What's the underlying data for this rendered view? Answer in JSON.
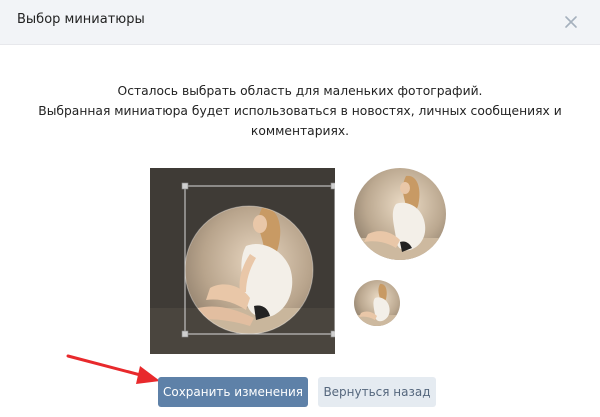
{
  "dialog": {
    "title": "Выбор миниатюры",
    "close_icon": "close-icon"
  },
  "instructions": {
    "line1": "Осталось выбрать область для маленьких фотографий.",
    "line2": "Выбранная миниатюра будет использоваться в новостях, личных сообщениях и",
    "line3": "комментариях."
  },
  "editor": {
    "crop_icon": "crop-selection",
    "photo_icon": "photo-woman-sitting"
  },
  "previews": {
    "large_icon": "photo-thumbnail-large",
    "small_icon": "photo-thumbnail-small"
  },
  "buttons": {
    "save_label": "Сохранить изменения",
    "back_label": "Вернуться назад"
  },
  "colors": {
    "header_bg": "#f2f4f7",
    "primary": "#5e81a8",
    "secondary_bg": "#e5ebf1",
    "secondary_text": "#55677d",
    "annotation_arrow": "#e8292c"
  }
}
